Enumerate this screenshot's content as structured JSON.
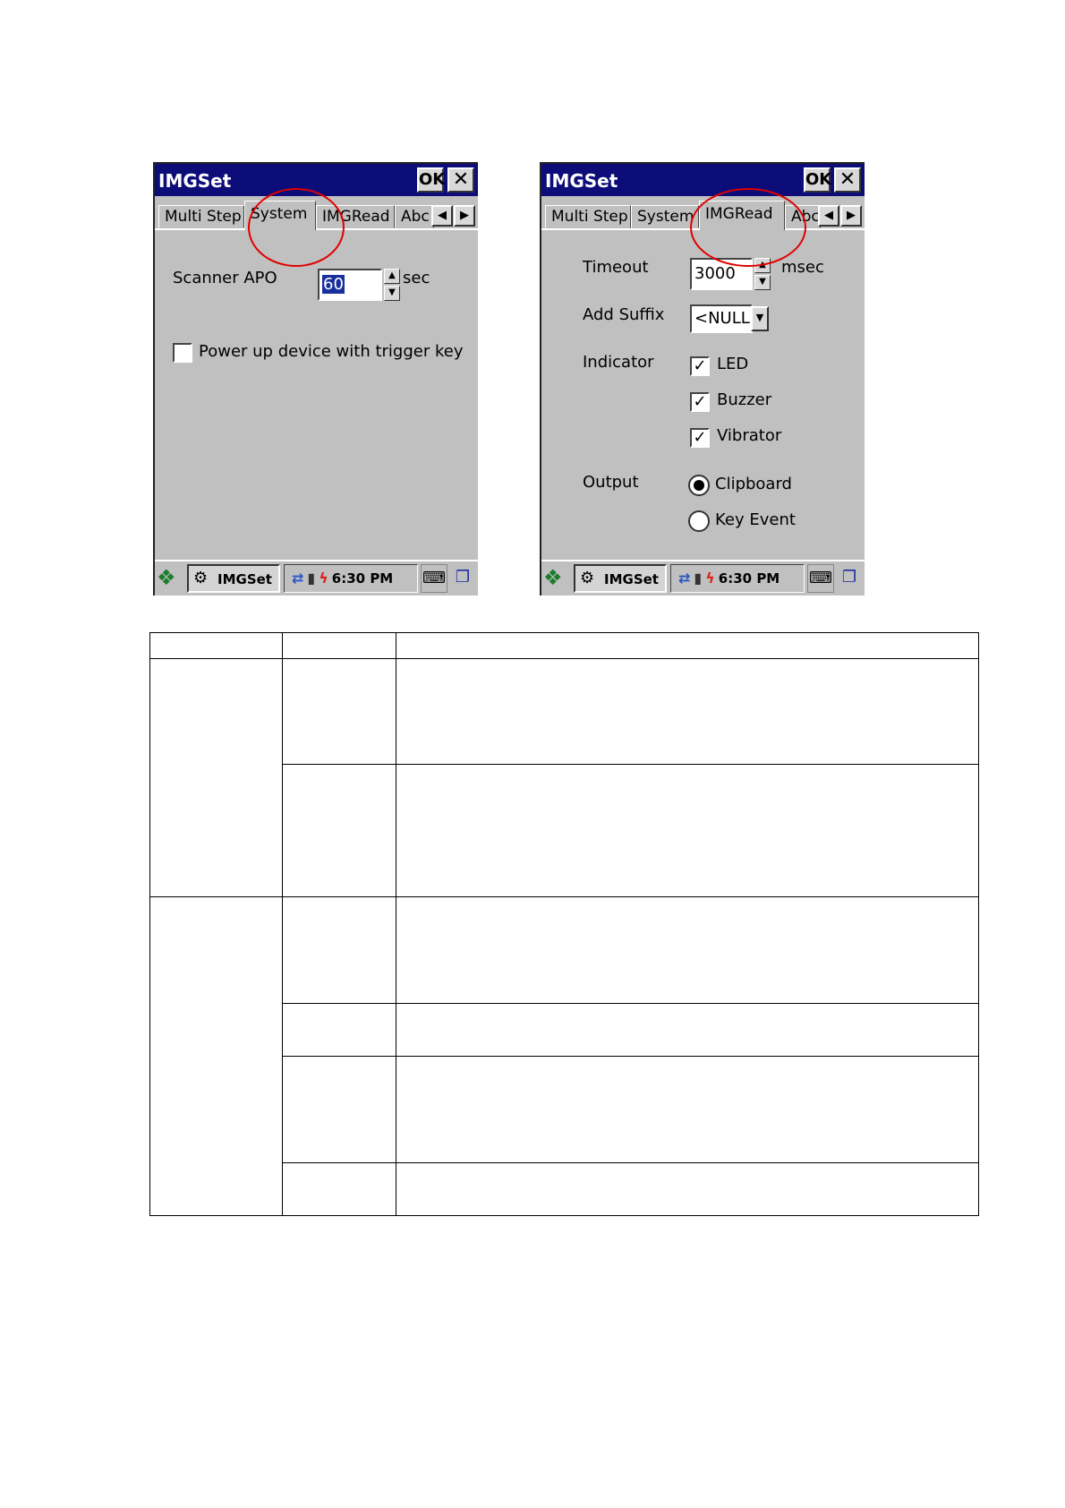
{
  "screens": [
    {
      "title": "IMGSet",
      "ok_label": "OK",
      "close_label": "✕",
      "tabs": [
        "Multi Step",
        "System",
        "IMGRead",
        "Abc"
      ],
      "active_tab": "System",
      "fields": {
        "scanner_apo_label": "Scanner APO",
        "scanner_apo_value": "60",
        "scanner_apo_unit": "sec",
        "power_up_label": "Power up device with trigger key",
        "power_up_checked": false
      },
      "taskbar": {
        "app_label": "IMGSet",
        "time": "6:30 PM"
      }
    },
    {
      "title": "IMGSet",
      "ok_label": "OK",
      "close_label": "✕",
      "tabs": [
        "Multi Step",
        "System",
        "IMGRead",
        "Abc"
      ],
      "active_tab": "IMGRead",
      "fields": {
        "timeout_label": "Timeout",
        "timeout_value": "3000",
        "timeout_unit": "msec",
        "add_suffix_label": "Add Suffix",
        "add_suffix_value": "<NULL:",
        "indicator_label": "Indicator",
        "indicator_options": [
          {
            "label": "LED",
            "checked": true
          },
          {
            "label": "Buzzer",
            "checked": true
          },
          {
            "label": "Vibrator",
            "checked": true
          }
        ],
        "output_label": "Output",
        "output_options": [
          {
            "label": "Clipboard",
            "selected": true
          },
          {
            "label": "Key Event",
            "selected": false
          }
        ]
      },
      "taskbar": {
        "app_label": "IMGSet",
        "time": "6:30 PM"
      }
    }
  ],
  "icons": {
    "start": "windows-flag-icon",
    "app": "imgset-app-icon",
    "network": "network-icon",
    "battery": "battery-icon",
    "keyboard": "keyboard-icon",
    "windows": "window-switch-icon"
  },
  "annotation_color": "#e00000",
  "table_rows": [
    {
      "group": "",
      "item": "",
      "desc": ""
    },
    {
      "group": "",
      "item": "",
      "desc": ""
    },
    {
      "group": "",
      "item": "",
      "desc": ""
    },
    {
      "group": "",
      "item": "",
      "desc": ""
    },
    {
      "group": "",
      "item": "",
      "desc": ""
    },
    {
      "group": "",
      "item": "",
      "desc": ""
    },
    {
      "group": "",
      "item": "",
      "desc": ""
    }
  ]
}
